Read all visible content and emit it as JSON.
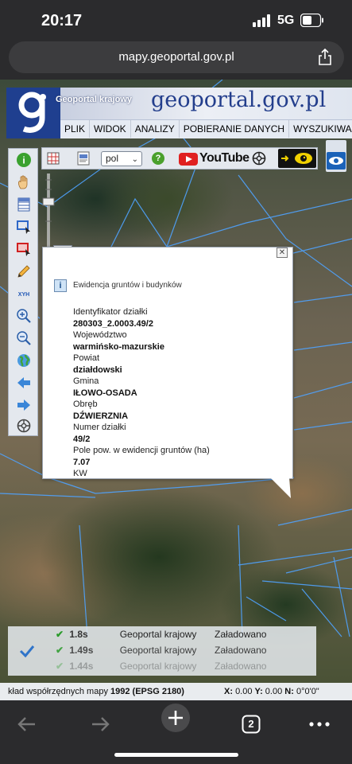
{
  "status_bar": {
    "time": "20:17",
    "network": "5G"
  },
  "browser": {
    "url": "mapy.geoportal.gov.pl",
    "tab_count": "2"
  },
  "header": {
    "subtitle": "Geoportal krajowy",
    "brand": "geoportal.gov.pl",
    "menu": [
      "PLIK",
      "WIDOK",
      "ANALIZY",
      "POBIERANIE DANYCH",
      "WYSZUKIWANIE"
    ]
  },
  "toolbar": {
    "language": "pol",
    "youtube_label": "YouTube",
    "help": "?"
  },
  "popup": {
    "title": "Ewidencja gruntów i budynków",
    "fields": [
      {
        "label": "Identyfikator działki",
        "value": "280303_2.0003.49/2"
      },
      {
        "label": "Województwo",
        "value": "warmińsko-mazurskie"
      },
      {
        "label": "Powiat",
        "value": "działdowski"
      },
      {
        "label": "Gmina",
        "value": "IŁOWO-OSADA"
      },
      {
        "label": "Obręb",
        "value": "DŹWIERZNIA"
      },
      {
        "label": "Numer działki",
        "value": "49/2"
      },
      {
        "label": "Pole pow. w ewidencji gruntów (ha)",
        "value": "7.07"
      },
      {
        "label": "KW",
        "value": ""
      }
    ]
  },
  "loading": [
    {
      "time": "1.8s",
      "source": "Geoportal krajowy",
      "status": "Załadowano"
    },
    {
      "time": "1.49s",
      "source": "Geoportal krajowy",
      "status": "Załadowano"
    },
    {
      "time": "1.44s",
      "source": "Geoportal krajowy",
      "status": "Załadowano"
    }
  ],
  "coords": {
    "system_prefix": "kład współrzędnych mapy ",
    "system_name": "1992 (EPSG 2180)",
    "x_label": "X:",
    "x_value": "0.00",
    "y_label": "Y:",
    "y_value": "0.00",
    "n_label": "N:",
    "n_value": "0°0'0\""
  },
  "colors": {
    "brand_blue": "#233e8c",
    "logo_bg": "#1f3f8f",
    "parcel_line": "#4fa3ff",
    "ok_green": "#2a9b2a"
  }
}
